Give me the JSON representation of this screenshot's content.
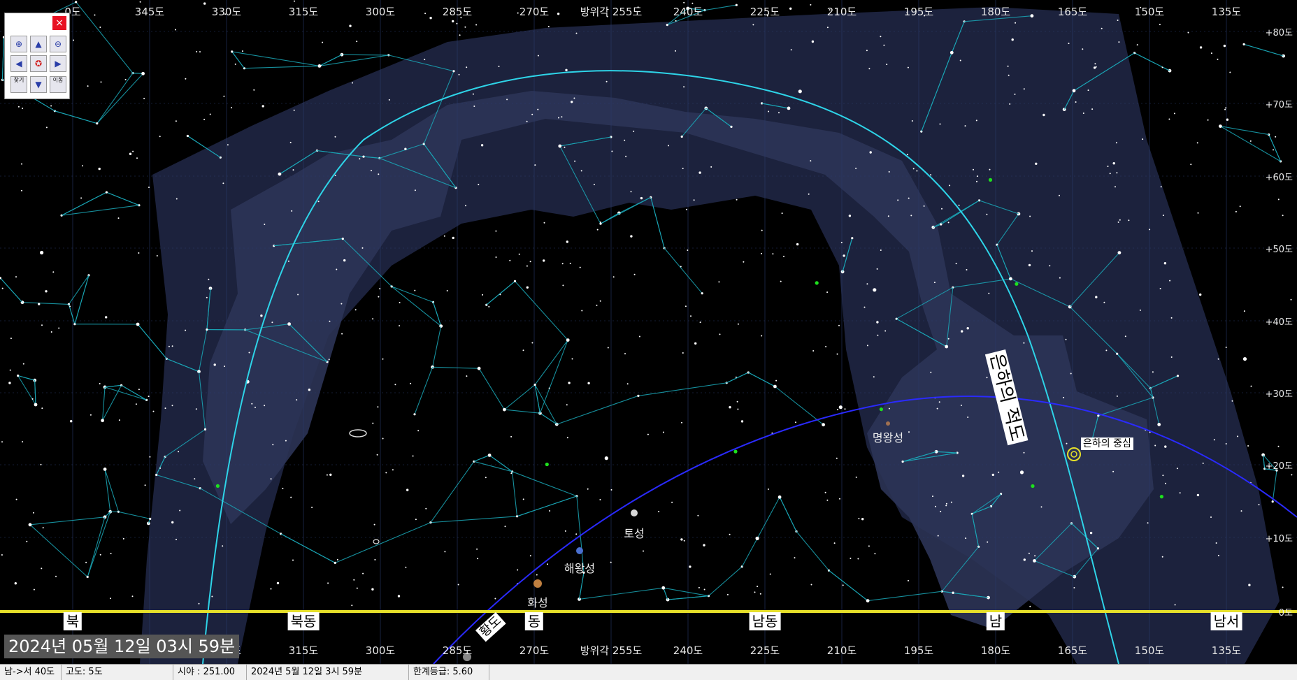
{
  "azimuth_labels": [
    "0도",
    "345도",
    "330도",
    "315도",
    "300도",
    "285도",
    "270도",
    "방위각 255도",
    "240도",
    "225도",
    "210도",
    "195도",
    "180도",
    "165도",
    "150도",
    "135도"
  ],
  "altitude_labels": [
    "+80도",
    "+70도",
    "+60도",
    "+50도",
    "+40도",
    "+30도",
    "+20도",
    "+10도",
    "0도"
  ],
  "directions": [
    "북",
    "북동",
    "동",
    "남동",
    "남",
    "남서"
  ],
  "planets": {
    "saturn": "토성",
    "neptune": "해왕성",
    "mars": "화성",
    "pluto": "명왕성"
  },
  "labels": {
    "galactic_equator": "은하의 적도",
    "galactic_center": "은하의 중심",
    "ecliptic": "황도"
  },
  "datestamp": "2024년 05월 12일 03시 59분",
  "statusbar": {
    "direction": "남->서  40도",
    "altitude": "고도:    5도",
    "fov": "시야 : 251.00",
    "datetime": "2024년  5월 12일  3시 59분",
    "limit_mag": "한계등급:  5.60"
  },
  "toolpanel": {
    "close": "×",
    "btn_find": "찾기",
    "btn_tile": "이동"
  },
  "colors": {
    "sky": "#000000",
    "milky_way": "#2a3050",
    "constellation_lines": "#1aa8b8",
    "galactic_equator": "#2ed4e8",
    "ecliptic": "#2a2aff",
    "horizon": "#e6e02a"
  }
}
